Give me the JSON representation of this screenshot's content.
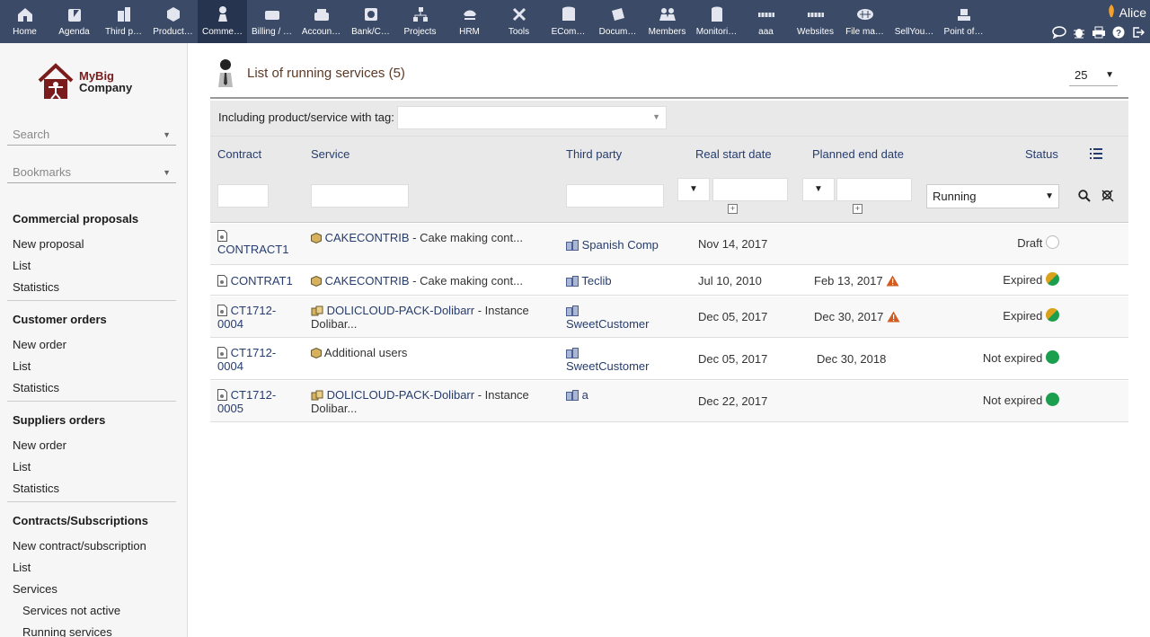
{
  "topbar": {
    "menu": [
      {
        "label": "Home",
        "icon": "home-icon"
      },
      {
        "label": "Agenda",
        "icon": "agenda-icon"
      },
      {
        "label": "Third p…",
        "icon": "building-icon"
      },
      {
        "label": "Product…",
        "icon": "product-icon"
      },
      {
        "label": "Comme…",
        "icon": "commercial-icon"
      },
      {
        "label": "Billing / …",
        "icon": "billing-icon"
      },
      {
        "label": "Accoun…",
        "icon": "accounting-icon"
      },
      {
        "label": "Bank/C…",
        "icon": "bank-icon"
      },
      {
        "label": "Projects",
        "icon": "projects-icon"
      },
      {
        "label": "HRM",
        "icon": "hrm-icon"
      },
      {
        "label": "Tools",
        "icon": "tools-icon"
      },
      {
        "label": "ECom…",
        "icon": "ecommerce-icon"
      },
      {
        "label": "Docum…",
        "icon": "documents-icon"
      },
      {
        "label": "Members",
        "icon": "members-icon"
      },
      {
        "label": "Monitori…",
        "icon": "monitoring-icon"
      },
      {
        "label": "aaa",
        "icon": "module-icon"
      },
      {
        "label": "Websites",
        "icon": "websites-icon"
      },
      {
        "label": "File ma…",
        "icon": "file-manager-icon"
      },
      {
        "label": "SellYou…",
        "icon": "sellyoursaas-icon"
      },
      {
        "label": "Point of…",
        "icon": "pos-icon"
      }
    ],
    "active_index": 4,
    "user": "Alice"
  },
  "sidebar": {
    "logo": {
      "line1": "MyBig",
      "line2": "Company"
    },
    "search_placeholder": "Search",
    "bookmarks_placeholder": "Bookmarks",
    "sections": [
      {
        "title": "Commercial proposals",
        "links": [
          "New proposal",
          "List",
          "Statistics"
        ]
      },
      {
        "title": "Customer orders",
        "links": [
          "New order",
          "List",
          "Statistics"
        ]
      },
      {
        "title": "Suppliers orders",
        "links": [
          "New order",
          "List",
          "Statistics"
        ]
      },
      {
        "title": "Contracts/Subscriptions",
        "links": [
          "New contract/subscription",
          "List",
          "Services"
        ],
        "sublinks": [
          "Services not active",
          "Running services"
        ]
      }
    ]
  },
  "main": {
    "title": "List of running services (5)",
    "limit": "25",
    "tag_filter_label": "Including product/service with tag:",
    "columns": {
      "contract": "Contract",
      "service": "Service",
      "third_party": "Third party",
      "real_start": "Real start date",
      "planned_end": "Planned end date",
      "status": "Status"
    },
    "status_filter": "Running",
    "rows": [
      {
        "contract": "CONTRACT1",
        "service_ref": "CAKECONTRIB",
        "service_desc": " - Cake making cont...",
        "third_party": "Spanish Comp",
        "start": "Nov 14, 2017",
        "end": "",
        "end_warning": false,
        "status": "Draft",
        "status_color": "draft"
      },
      {
        "contract": "CONTRAT1",
        "service_ref": "CAKECONTRIB",
        "service_desc": " - Cake making cont...",
        "third_party": "Teclib",
        "start": "Jul 10, 2010",
        "end": "Feb 13, 2017",
        "end_warning": true,
        "status": "Expired",
        "status_color": "expired"
      },
      {
        "contract": "CT1712-0004",
        "service_ref": "DOLICLOUD-PACK-Dolibarr",
        "service_desc": " - Instance Dolibar...",
        "third_party": "SweetCustomer",
        "start": "Dec 05, 2017",
        "end": "Dec 30, 2017",
        "end_warning": true,
        "status": "Expired",
        "status_color": "expired"
      },
      {
        "contract": "CT1712-0004",
        "service_ref": "",
        "service_desc": "Additional users",
        "third_party": "SweetCustomer",
        "start": "Dec 05, 2017",
        "end": "Dec 30, 2018",
        "end_warning": false,
        "status": "Not expired",
        "status_color": "active"
      },
      {
        "contract": "CT1712-0005",
        "service_ref": "DOLICLOUD-PACK-Dolibarr",
        "service_desc": " - Instance Dolibar...",
        "third_party": "a",
        "start": "Dec 22, 2017",
        "end": "",
        "end_warning": false,
        "status": "Not expired",
        "status_color": "active"
      }
    ]
  },
  "colors": {
    "topbar": "#3b4a66",
    "link": "#263c6e",
    "active": "#1c9e4f",
    "warning": "#d35b1f"
  }
}
